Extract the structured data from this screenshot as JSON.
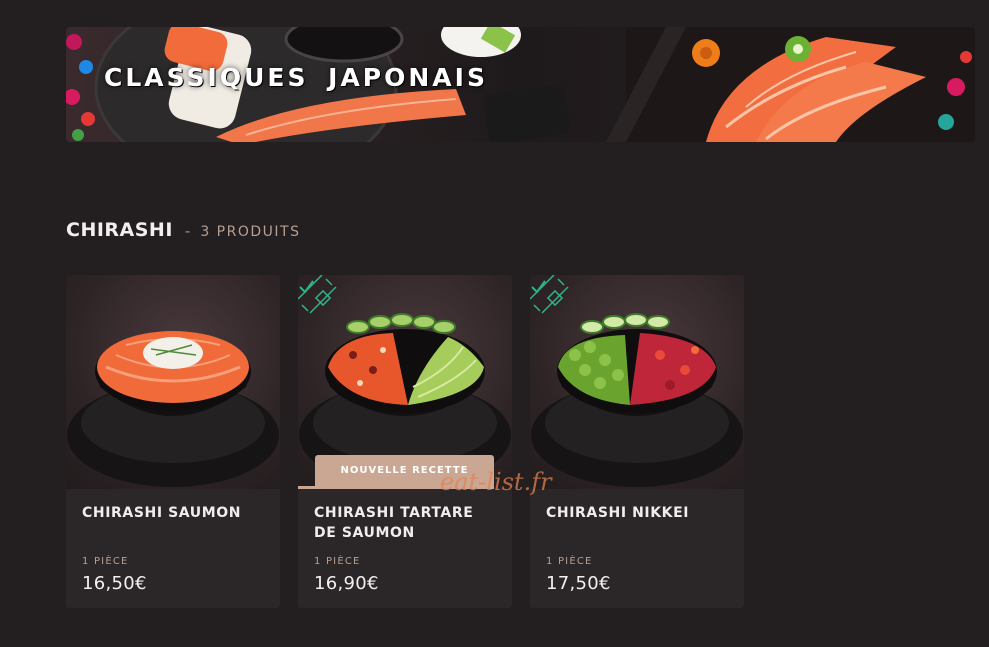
{
  "banner": {
    "title": "CLASSIQUES  JAPONAIS"
  },
  "section": {
    "title": "CHIRASHI",
    "separator": "-",
    "count": "3 PRODUITS"
  },
  "products": [
    {
      "name": "CHIRASHI SAUMON",
      "quantity": "1 PIÈCE",
      "price": "16,50€",
      "badge": null
    },
    {
      "name": "CHIRASHI TARTARE DE SAUMON",
      "quantity": "1 PIÈCE",
      "price": "16,90€",
      "badge": "NOUVELLE RECETTE"
    },
    {
      "name": "CHIRASHI NIKKEI",
      "quantity": "1 PIÈCE",
      "price": "17,50€",
      "badge": null
    }
  ],
  "watermark": "eat-list.fr",
  "colors": {
    "background": "#231f21",
    "card": "#2b2628",
    "accent": "#c9a792",
    "muted_text": "#b79f91"
  },
  "icons": [
    "new-recipe-deco-icon"
  ]
}
